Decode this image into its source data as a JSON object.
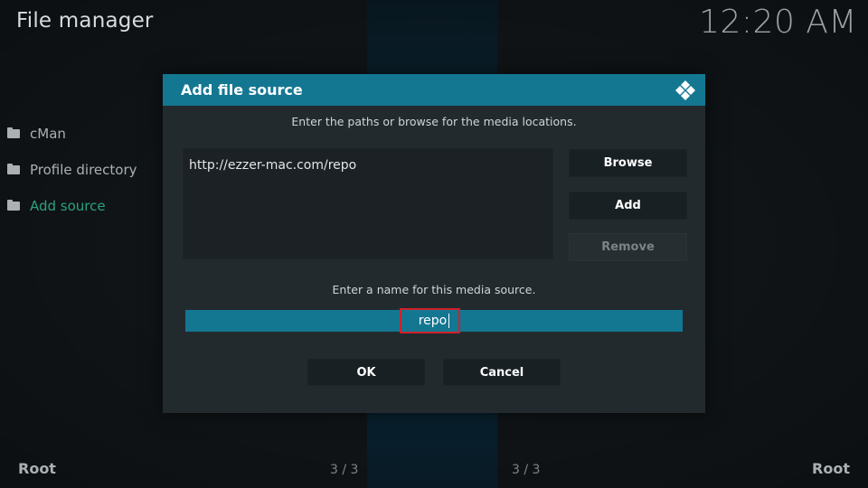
{
  "header": {
    "title": "File manager",
    "clock": "12:20 AM"
  },
  "sidebar": {
    "items": [
      {
        "label": "cMan",
        "icon": "folder-icon",
        "active": false
      },
      {
        "label": "Profile directory",
        "icon": "folder-icon",
        "active": false
      },
      {
        "label": "Add source",
        "icon": "folder-icon",
        "active": true
      }
    ]
  },
  "footer": {
    "left_label": "Root",
    "right_label": "Root",
    "left_counter": "3 / 3",
    "right_counter": "3 / 3"
  },
  "dialog": {
    "title": "Add file source",
    "logo_icon": "kodi-logo-icon",
    "paths_hint": "Enter the paths or browse for the media locations.",
    "paths": [
      "http://ezzer-mac.com/repo"
    ],
    "browse_label": "Browse",
    "add_label": "Add",
    "remove_label": "Remove",
    "name_hint": "Enter a name for this media source.",
    "name_value": "repo",
    "ok_label": "OK",
    "cancel_label": "Cancel"
  },
  "colors": {
    "accent": "#147792",
    "active_item": "#2aa37c",
    "highlight_box": "#d0212a"
  }
}
